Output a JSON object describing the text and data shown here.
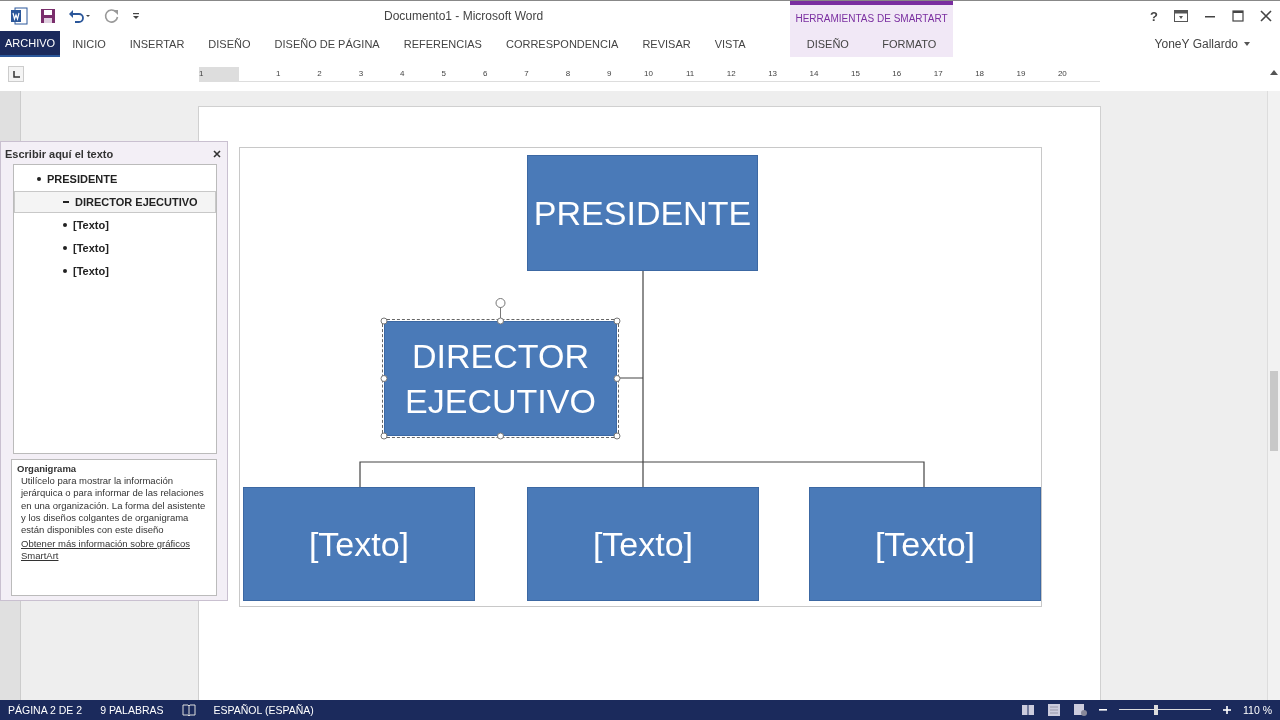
{
  "window": {
    "title": "Documento1 - Microsoft Word",
    "contextual_group": "HERRAMIENTAS DE SMARTART",
    "help": "?",
    "user": "YoneY Gallardo"
  },
  "tabs": [
    {
      "label": "ARCHIVO",
      "selected": true,
      "kind": "file"
    },
    {
      "label": "INICIO",
      "selected": false,
      "kind": "main"
    },
    {
      "label": "INSERTAR",
      "selected": false,
      "kind": "main"
    },
    {
      "label": "DISEÑO",
      "selected": false,
      "kind": "main"
    },
    {
      "label": "DISEÑO DE PÁGINA",
      "selected": false,
      "kind": "main"
    },
    {
      "label": "REFERENCIAS",
      "selected": false,
      "kind": "main"
    },
    {
      "label": "CORRESPONDENCIA",
      "selected": false,
      "kind": "main"
    },
    {
      "label": "REVISAR",
      "selected": false,
      "kind": "main"
    },
    {
      "label": "VISTA",
      "selected": false,
      "kind": "main"
    },
    {
      "label": "DISEÑO",
      "selected": false,
      "kind": "contextual"
    },
    {
      "label": "FORMATO",
      "selected": false,
      "kind": "contextual"
    }
  ],
  "ruler": {
    "labels": [
      "1",
      "1",
      "2",
      "3",
      "4",
      "5",
      "6",
      "7",
      "8",
      "9",
      "10",
      "11",
      "12",
      "13",
      "14",
      "15",
      "16",
      "17",
      "18",
      "19",
      "20"
    ]
  },
  "text_pane": {
    "title": "Escribir aquí el texto",
    "items": [
      {
        "text": "PRESIDENTE",
        "selected": false,
        "kind": "bullet",
        "children": [
          {
            "text": "DIRECTOR EJECUTIVO",
            "selected": true,
            "kind": "assistant"
          },
          {
            "text": "[Texto]",
            "selected": false,
            "kind": "bullet"
          },
          {
            "text": "[Texto]",
            "selected": false,
            "kind": "bullet"
          },
          {
            "text": "[Texto]",
            "selected": false,
            "kind": "bullet"
          }
        ]
      }
    ],
    "description": {
      "title": "Organigrama",
      "body": "Utilícelo para mostrar la información jerárquica o para informar de las relaciones en una organización. La forma del asistente y los diseños colgantes de organigrama están disponibles con este diseño",
      "link": "Obtener más información sobre gráficos SmartArt"
    }
  },
  "diagram": {
    "root": {
      "text": "PRESIDENTE",
      "selected": false
    },
    "assistant": {
      "text": "DIRECTOR EJECUTIVO",
      "selected": true
    },
    "subordinates": [
      {
        "text": "[Texto]",
        "selected": false
      },
      {
        "text": "[Texto]",
        "selected": false
      },
      {
        "text": "[Texto]",
        "selected": false
      }
    ]
  },
  "status_bar": {
    "page": "PÁGINA 2 DE 2",
    "words": "9 PALABRAS",
    "language": "ESPAÑOL (ESPAÑA)",
    "zoom": "110 %",
    "zoom_slider": {
      "level": 0.4
    }
  }
}
